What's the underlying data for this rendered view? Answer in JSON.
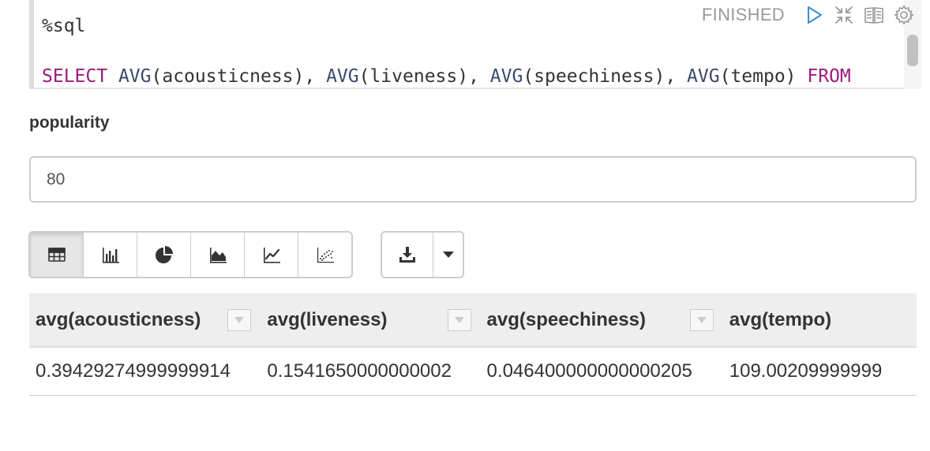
{
  "editor": {
    "line1": "%sql",
    "line2_tokens": [
      {
        "text": "SELECT",
        "cls": "kw"
      },
      {
        "text": " ",
        "cls": ""
      },
      {
        "text": "AVG",
        "cls": "fn"
      },
      {
        "text": "(acousticness), ",
        "cls": ""
      },
      {
        "text": "AVG",
        "cls": "fn"
      },
      {
        "text": "(liveness), ",
        "cls": ""
      },
      {
        "text": "AVG",
        "cls": "fn"
      },
      {
        "text": "(speechiness), ",
        "cls": ""
      },
      {
        "text": "AVG",
        "cls": "fn"
      },
      {
        "text": "(tempo) ",
        "cls": ""
      },
      {
        "text": "FROM",
        "cls": "kw"
      }
    ]
  },
  "paragraph": {
    "status": "FINISHED",
    "icons": [
      "run-icon",
      "collapse-icon",
      "book-icon",
      "gear-icon"
    ]
  },
  "form": {
    "label": "popularity",
    "value": "80"
  },
  "toolbar": {
    "viz_buttons": [
      "table-icon",
      "bar-chart-icon",
      "pie-chart-icon",
      "area-chart-icon",
      "line-chart-icon",
      "scatter-chart-icon"
    ],
    "active": "table-icon",
    "download_icon": "download-icon",
    "caret_icon": "caret-down-icon"
  },
  "table": {
    "columns": [
      "avg(acousticness)",
      "avg(liveness)",
      "avg(speechiness)",
      "avg(tempo)"
    ],
    "rows": [
      [
        "0.39429274999999914",
        "0.1541650000000002",
        "0.046400000000000205",
        "109.00209999999"
      ]
    ]
  },
  "colors": {
    "keyword": "#9c1b7c",
    "function": "#3b4a6b",
    "run_icon": "#3d8bd4"
  }
}
